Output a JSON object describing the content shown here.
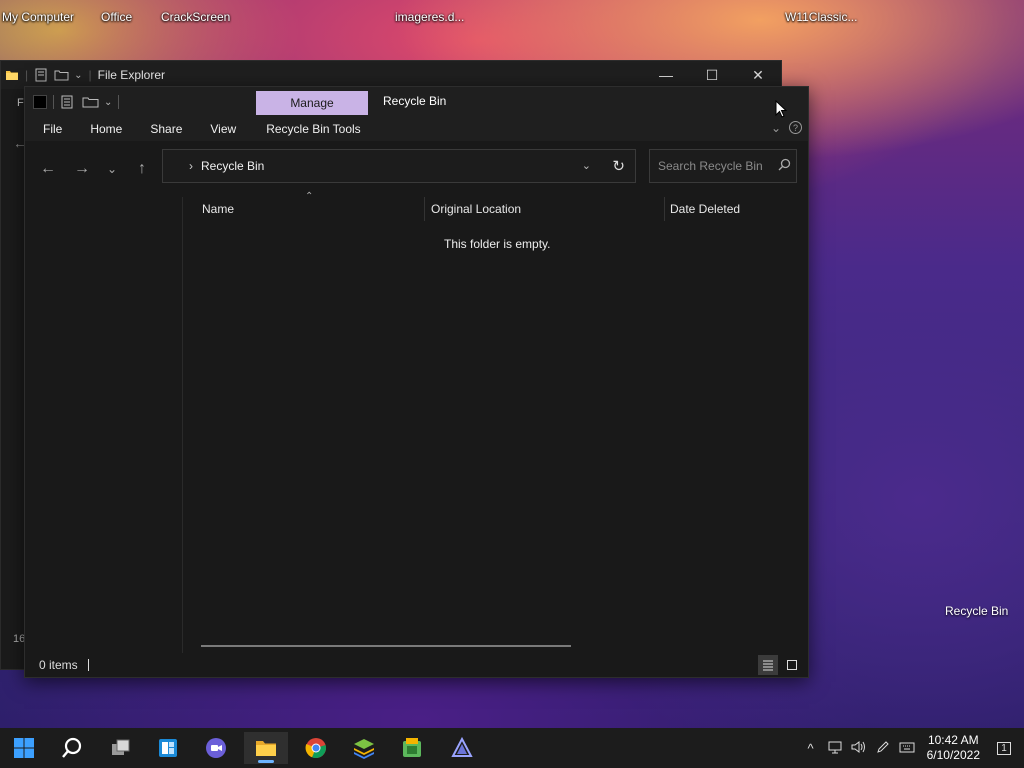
{
  "desktop": {
    "icons_top": [
      {
        "label": "My Computer"
      },
      {
        "label": "Office"
      },
      {
        "label": "CrackScreen"
      },
      {
        "label": "imageres.d..."
      },
      {
        "label": "W11Classic..."
      }
    ],
    "icon_bottom": {
      "label": "Recycle Bin"
    }
  },
  "back_window": {
    "title": "File Explorer",
    "minimize": "—",
    "maximize": "☐",
    "close": "✕",
    "side_letter": "Fi",
    "count_fragment": "16"
  },
  "window": {
    "manage_label": "Manage",
    "title": "Recycle Bin",
    "ribbon_tabs": [
      "File",
      "Home",
      "Share",
      "View",
      "Recycle Bin Tools"
    ],
    "address": {
      "crumb": "Recycle Bin"
    },
    "search": {
      "placeholder": "Search Recycle Bin"
    },
    "columns": [
      "Name",
      "Original Location",
      "Date Deleted"
    ],
    "empty_message": "This folder is empty.",
    "status": {
      "count": "0 items"
    }
  },
  "taskbar": {
    "clock": {
      "time": "10:42 AM",
      "date": "6/10/2022"
    },
    "notification_count": "1"
  },
  "colors": {
    "manage_tab": "#c9b3e6",
    "window_bg": "#191919",
    "taskbar_bg": "#1c1c1c"
  }
}
